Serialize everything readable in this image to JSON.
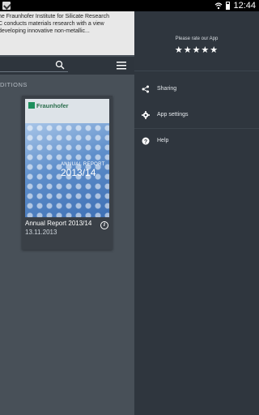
{
  "status_bar": {
    "time": "12:44"
  },
  "intro": {
    "lines": [
      "he Fraunhofer Institute for Silicate Research",
      "C conducts materials research with a view",
      "developing innovative non-metallic..."
    ]
  },
  "section": {
    "label": "DITIONS"
  },
  "card": {
    "cover_logo": "Fraunhofer",
    "cover_line1": "ANNUAL REPORT",
    "cover_line2": "2013/14",
    "title": "Annual Report 2013/14",
    "date": "13.11.2013"
  },
  "drawer": {
    "rate_label": "Please rate our App",
    "stars": "★★★★★",
    "items": [
      {
        "label": "Sharing",
        "icon": "share-icon"
      },
      {
        "label": "App settings",
        "icon": "gear-icon"
      },
      {
        "label": "Help",
        "icon": "help-icon"
      }
    ]
  }
}
